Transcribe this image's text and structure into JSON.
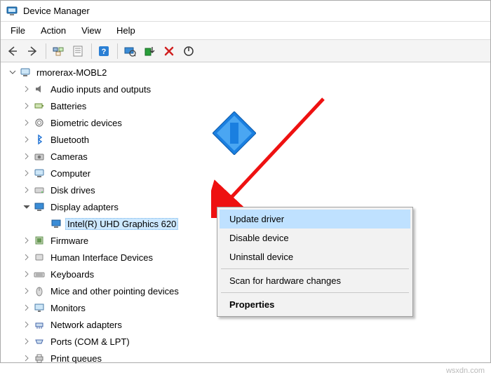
{
  "window": {
    "title": "Device Manager"
  },
  "menu": {
    "file": "File",
    "action": "Action",
    "view": "View",
    "help": "Help"
  },
  "toolbar_icons": {
    "back": "arrow-left-icon",
    "forward": "arrow-right-icon",
    "up": "up-tree-icon",
    "show": "show-hidden-icon",
    "help": "help-icon",
    "refresh": "refresh-icon",
    "update": "update-driver-icon",
    "uninstall": "uninstall-device-icon",
    "disable": "disable-device-icon"
  },
  "tree": {
    "root": "rmorerax-MOBL2",
    "nodes": [
      {
        "label": "Audio inputs and outputs",
        "expanded": false
      },
      {
        "label": "Batteries",
        "expanded": false
      },
      {
        "label": "Biometric devices",
        "expanded": false
      },
      {
        "label": "Bluetooth",
        "expanded": false
      },
      {
        "label": "Cameras",
        "expanded": false
      },
      {
        "label": "Computer",
        "expanded": false
      },
      {
        "label": "Disk drives",
        "expanded": false
      },
      {
        "label": "Display adapters",
        "expanded": true,
        "children": [
          {
            "label": "Intel(R) UHD Graphics 620",
            "selected": true
          }
        ]
      },
      {
        "label": "Firmware",
        "expanded": false
      },
      {
        "label": "Human Interface Devices",
        "expanded": false
      },
      {
        "label": "Keyboards",
        "expanded": false
      },
      {
        "label": "Mice and other pointing devices",
        "expanded": false
      },
      {
        "label": "Monitors",
        "expanded": false
      },
      {
        "label": "Network adapters",
        "expanded": false
      },
      {
        "label": "Ports (COM & LPT)",
        "expanded": false
      },
      {
        "label": "Print queues",
        "expanded": false
      }
    ]
  },
  "context_menu": {
    "update": "Update driver",
    "disable": "Disable device",
    "uninstall": "Uninstall device",
    "scan": "Scan for hardware changes",
    "properties": "Properties"
  },
  "watermark": "wsxdn.com"
}
